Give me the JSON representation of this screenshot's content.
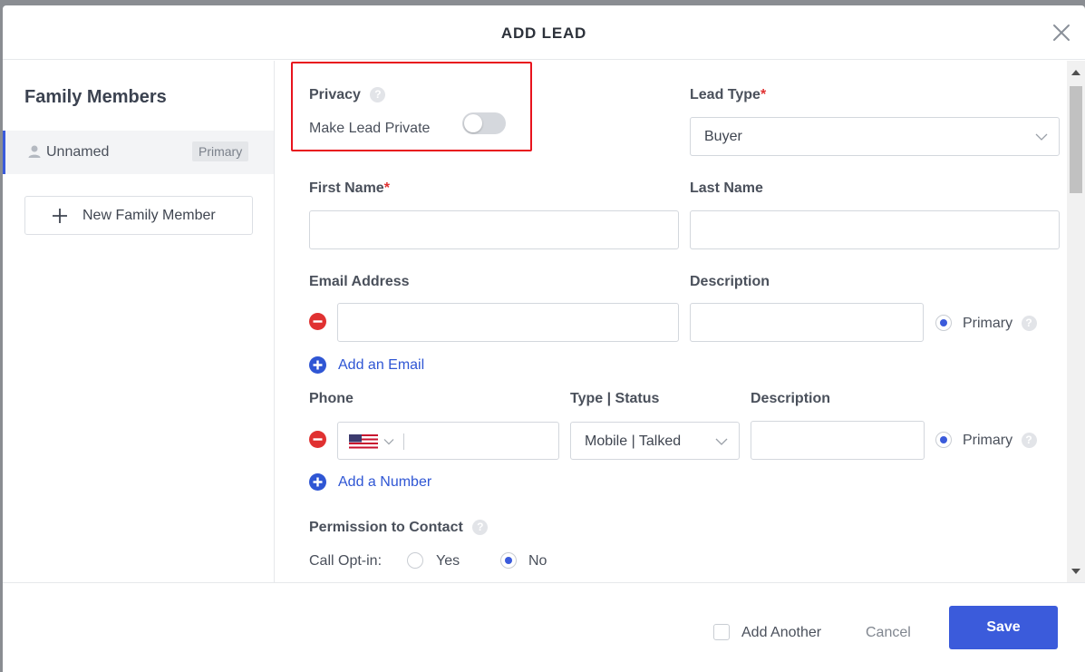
{
  "modal": {
    "title": "ADD LEAD"
  },
  "sidebar": {
    "title": "Family Members",
    "members": [
      {
        "name": "Unnamed",
        "badge": "Primary"
      }
    ],
    "new_member_label": "New Family Member"
  },
  "privacy": {
    "label": "Privacy",
    "toggle_label": "Make Lead Private",
    "toggle_on": false
  },
  "lead_type": {
    "label": "Lead Type",
    "required_mark": "*",
    "value": "Buyer"
  },
  "first_name": {
    "label": "First Name",
    "required_mark": "*",
    "value": ""
  },
  "last_name": {
    "label": "Last Name",
    "value": ""
  },
  "email": {
    "label": "Email Address",
    "description_label": "Description",
    "primary_label": "Primary",
    "add_label": "Add an Email"
  },
  "phone": {
    "label": "Phone",
    "type_status_label": "Type | Status",
    "description_label": "Description",
    "type_status_value": "Mobile | Talked",
    "primary_label": "Primary",
    "add_label": "Add a Number"
  },
  "permission": {
    "label": "Permission to Contact",
    "call_optin_label": "Call Opt-in:",
    "yes_label": "Yes",
    "no_label": "No",
    "selected": "No"
  },
  "footer": {
    "add_another_label": "Add Another",
    "cancel_label": "Cancel",
    "save_label": "Save"
  },
  "colors": {
    "accent": "#3b5bdb",
    "link": "#2f56d4",
    "danger": "#e03131",
    "highlight": "#e8131d"
  },
  "icons": {
    "close": "close-icon",
    "user": "user-icon",
    "plus": "plus-icon",
    "help": "help-icon",
    "remove": "remove-circle-icon",
    "add": "add-circle-icon",
    "chevron": "chevron-down-icon",
    "flag": "us-flag-icon"
  }
}
